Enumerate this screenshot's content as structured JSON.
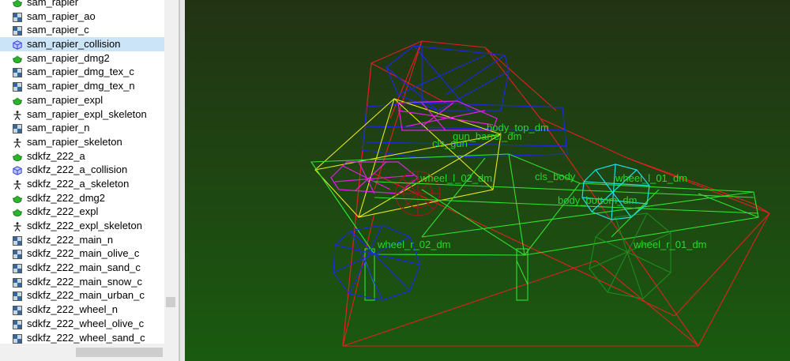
{
  "asset_list": {
    "items": [
      {
        "label": "sam_rapier",
        "icon": "teapot-icon"
      },
      {
        "label": "sam_rapier_ao",
        "icon": "texture-icon"
      },
      {
        "label": "sam_rapier_c",
        "icon": "texture-icon"
      },
      {
        "label": "sam_rapier_collision",
        "icon": "collision-cube-icon",
        "selected": true
      },
      {
        "label": "sam_rapier_dmg2",
        "icon": "teapot-icon"
      },
      {
        "label": "sam_rapier_dmg_tex_c",
        "icon": "texture-icon"
      },
      {
        "label": "sam_rapier_dmg_tex_n",
        "icon": "texture-icon"
      },
      {
        "label": "sam_rapier_expl",
        "icon": "teapot-icon"
      },
      {
        "label": "sam_rapier_expl_skeleton",
        "icon": "skeleton-icon"
      },
      {
        "label": "sam_rapier_n",
        "icon": "texture-icon"
      },
      {
        "label": "sam_rapier_skeleton",
        "icon": "skeleton-icon"
      },
      {
        "label": "sdkfz_222_a",
        "icon": "teapot-icon"
      },
      {
        "label": "sdkfz_222_a_collision",
        "icon": "collision-cube-icon"
      },
      {
        "label": "sdkfz_222_a_skeleton",
        "icon": "skeleton-icon"
      },
      {
        "label": "sdkfz_222_dmg2",
        "icon": "teapot-icon"
      },
      {
        "label": "sdkfz_222_expl",
        "icon": "teapot-icon"
      },
      {
        "label": "sdkfz_222_expl_skeleton",
        "icon": "skeleton-icon"
      },
      {
        "label": "sdkfz_222_main_n",
        "icon": "texture-icon"
      },
      {
        "label": "sdkfz_222_main_olive_c",
        "icon": "texture-icon"
      },
      {
        "label": "sdkfz_222_main_sand_c",
        "icon": "texture-icon"
      },
      {
        "label": "sdkfz_222_main_snow_c",
        "icon": "texture-icon"
      },
      {
        "label": "sdkfz_222_main_urban_c",
        "icon": "texture-icon"
      },
      {
        "label": "sdkfz_222_wheel_n",
        "icon": "texture-icon"
      },
      {
        "label": "sdkfz_222_wheel_olive_c",
        "icon": "texture-icon"
      },
      {
        "label": "sdkfz_222_wheel_sand_c",
        "icon": "texture-icon"
      }
    ]
  },
  "viewport": {
    "colors": {
      "bg_top": "#223314",
      "bg_bottom": "#1a5a10",
      "label": "#28d828",
      "red": "#e02020",
      "blue": "#1a2adc",
      "yellow": "#e8e81a",
      "magenta": "#e020e0",
      "green": "#30e030",
      "cyan": "#20dede"
    },
    "labels": {
      "body_top_dm": "body_top_dm",
      "gun_barrel_dm": "gun_barrel_dm",
      "cls_gun": "cls_gun",
      "cls_body": "cls_body",
      "wheel_l_02_dm": "wheel_l_02_dm",
      "wheel_l_01_dm": "wheel_l_01_dm",
      "body_bottom_dm": "body_bottom_dm",
      "wheel_r_02_dm": "wheel_r_02_dm",
      "wheel_r_01_dm": "wheel_r_01_dm"
    }
  }
}
